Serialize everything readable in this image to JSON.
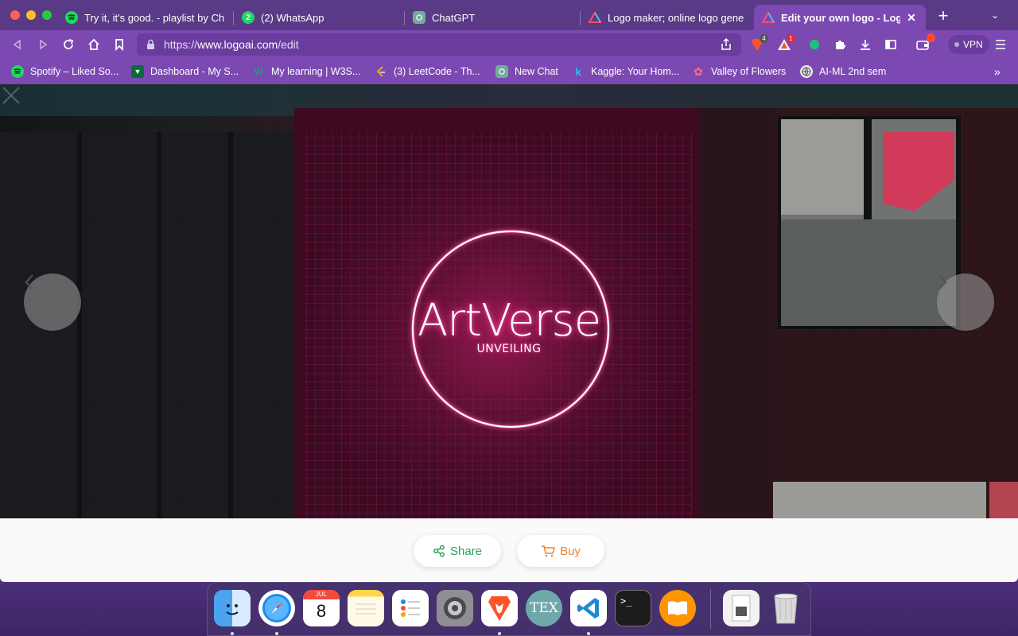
{
  "browser": {
    "tabs": [
      {
        "title": "Try it, it's good. - playlist by Ch",
        "icon": "spotify-icon",
        "active": false
      },
      {
        "title": "(2) WhatsApp",
        "icon": "whatsapp-icon",
        "badge": "2",
        "active": false
      },
      {
        "title": "ChatGPT",
        "icon": "chatgpt-icon",
        "active": false
      },
      {
        "title": "Logo maker; online logo generat",
        "icon": "logoai-icon",
        "active": false
      },
      {
        "title": "Edit your own logo - LogoAI",
        "icon": "logoai-icon",
        "active": true
      }
    ],
    "new_tab_label": "+",
    "url": {
      "scheme": "https://",
      "host": "www.logoai.com",
      "path": "/edit"
    },
    "extensions": {
      "brave_shield_count": "4",
      "brave_rewards_count": "1"
    },
    "vpn_label": "VPN",
    "bookmarks": [
      {
        "label": "Spotify – Liked So...",
        "icon": "spotify-icon"
      },
      {
        "label": "Dashboard - My S...",
        "icon": "shield-icon"
      },
      {
        "label": "My learning | W3S...",
        "icon": "w3schools-icon"
      },
      {
        "label": "(3) LeetCode - Th...",
        "icon": "leetcode-icon"
      },
      {
        "label": "New Chat",
        "icon": "chatgpt-icon"
      },
      {
        "label": "Kaggle: Your Hom...",
        "icon": "kaggle-icon"
      },
      {
        "label": "Valley of Flowers",
        "icon": "flower-icon"
      },
      {
        "label": "AI-ML 2nd sem",
        "icon": "globe-icon"
      }
    ],
    "bookmarks_overflow": "»"
  },
  "logo": {
    "name": "ArtVerse",
    "tagline": "UNVEILING"
  },
  "actions": {
    "share_label": "Share",
    "buy_label": "Buy"
  },
  "dock": {
    "apps": [
      "finder-icon",
      "safari-icon",
      "calendar-icon",
      "notes-icon",
      "reminders-icon",
      "system-preferences-icon",
      "brave-icon",
      "tex-icon",
      "vscode-icon",
      "terminal-icon",
      "books-icon",
      "downloads-stack-icon",
      "trash-icon"
    ],
    "calendar_month": "JUL",
    "calendar_day": "8"
  },
  "colors": {
    "tab_strip": "#5a3a86",
    "toolbar": "#7c49b3",
    "share_green": "#2aa35a",
    "buy_orange": "#f3822e",
    "neon_pink": "#ff2f8c"
  }
}
